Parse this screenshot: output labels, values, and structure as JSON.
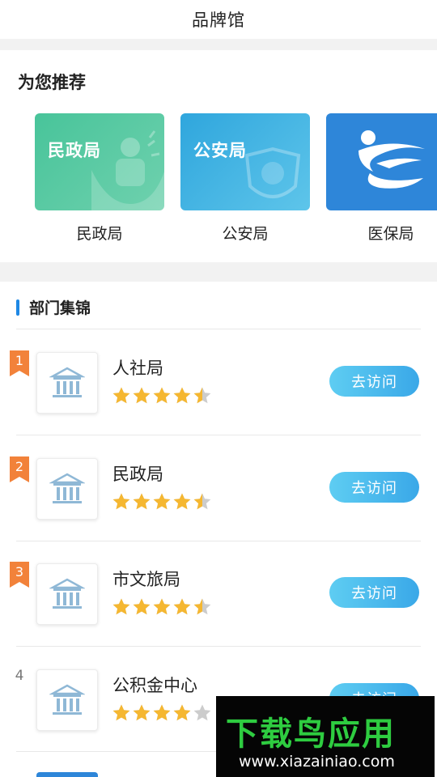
{
  "header": {
    "title": "品牌馆"
  },
  "recommend": {
    "title": "为您推荐",
    "cards": [
      {
        "thumb_text": "民政局",
        "label": "民政局",
        "theme": "#48c49a"
      },
      {
        "thumb_text": "公安局",
        "label": "公安局",
        "theme": "#2fa6dd"
      },
      {
        "thumb_text": "",
        "label": "医保局",
        "theme": "#2e86d9"
      }
    ]
  },
  "departments": {
    "title": "部门集锦",
    "button_label": "去访问",
    "items": [
      {
        "rank": "1",
        "name": "人社局",
        "rating": 4.5
      },
      {
        "rank": "2",
        "name": "民政局",
        "rating": 4.5
      },
      {
        "rank": "3",
        "name": "市文旅局",
        "rating": 4.5
      },
      {
        "rank": "4",
        "name": "公积金中心",
        "rating": 4
      }
    ]
  },
  "watermark": {
    "text": "下载鸟应用",
    "url": "www.xiazainiao.com"
  },
  "colors": {
    "accent": "#1e88e5",
    "star": "#f5b731",
    "star_empty": "#cccccc",
    "rank_flag": "#f2823a",
    "button": "#3aa8e8"
  }
}
